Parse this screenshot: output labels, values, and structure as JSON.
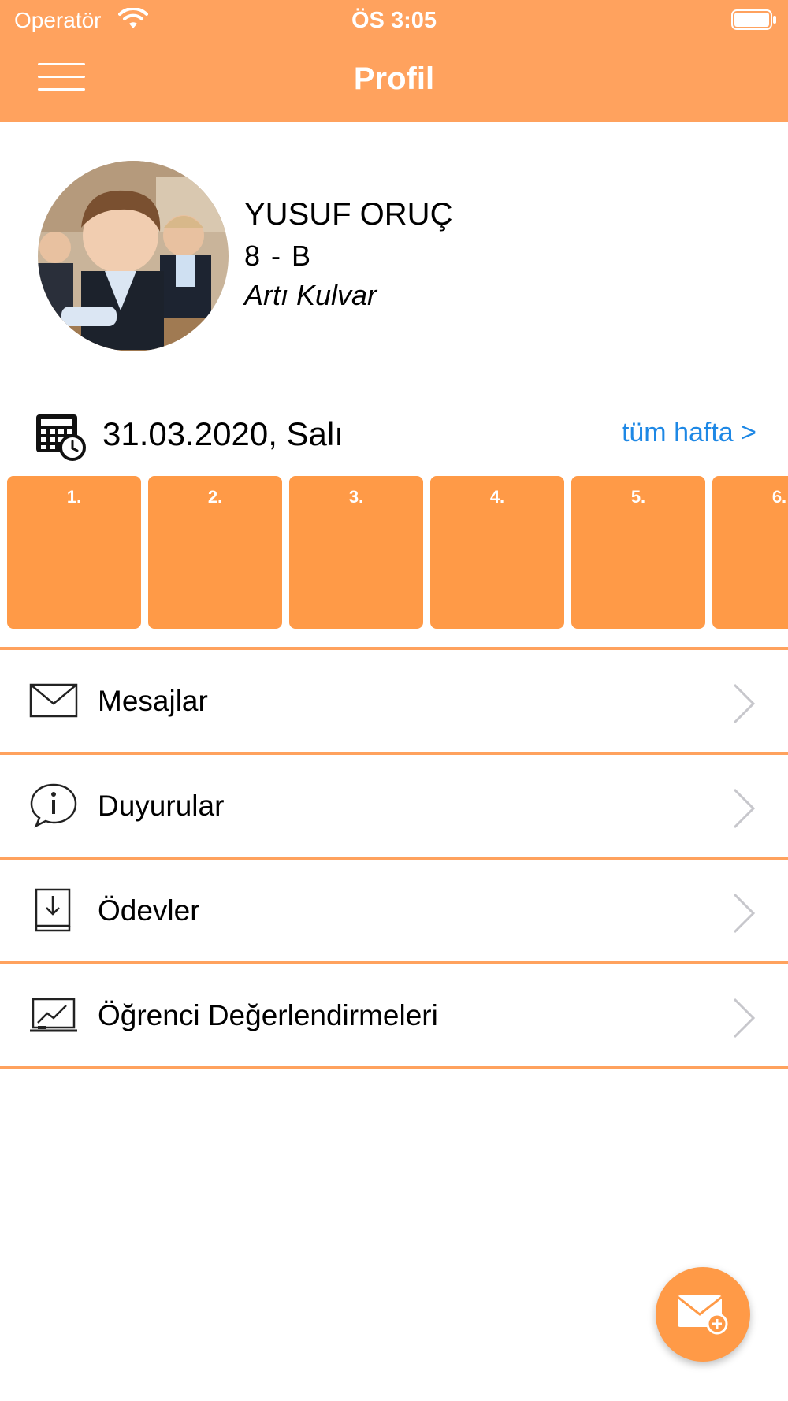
{
  "status_bar": {
    "carrier": "Operatör",
    "time": "ÖS 3:05"
  },
  "header": {
    "title": "Profil",
    "background_color": "#FFA25E"
  },
  "profile": {
    "name": "YUSUF ORUÇ",
    "class": "8 - B",
    "branch": "Artı Kulvar"
  },
  "schedule": {
    "date": "31.03.2020, Salı",
    "week_link": "tüm hafta >",
    "periods": [
      {
        "label": "1."
      },
      {
        "label": "2."
      },
      {
        "label": "3."
      },
      {
        "label": "4."
      },
      {
        "label": "5."
      },
      {
        "label": "6."
      }
    ],
    "period_color": "#FF9A47"
  },
  "menu": {
    "items": [
      {
        "label": "Mesajlar",
        "icon": "envelope-icon"
      },
      {
        "label": "Duyurular",
        "icon": "info-bubble-icon"
      },
      {
        "label": "Ödevler",
        "icon": "homework-book-icon"
      },
      {
        "label": "Öğrenci Değerlendirmeleri",
        "icon": "chart-board-icon"
      }
    ]
  },
  "fab": {
    "icon": "new-message-icon"
  },
  "colors": {
    "accent": "#FFA25E",
    "link": "#1E88E5"
  }
}
